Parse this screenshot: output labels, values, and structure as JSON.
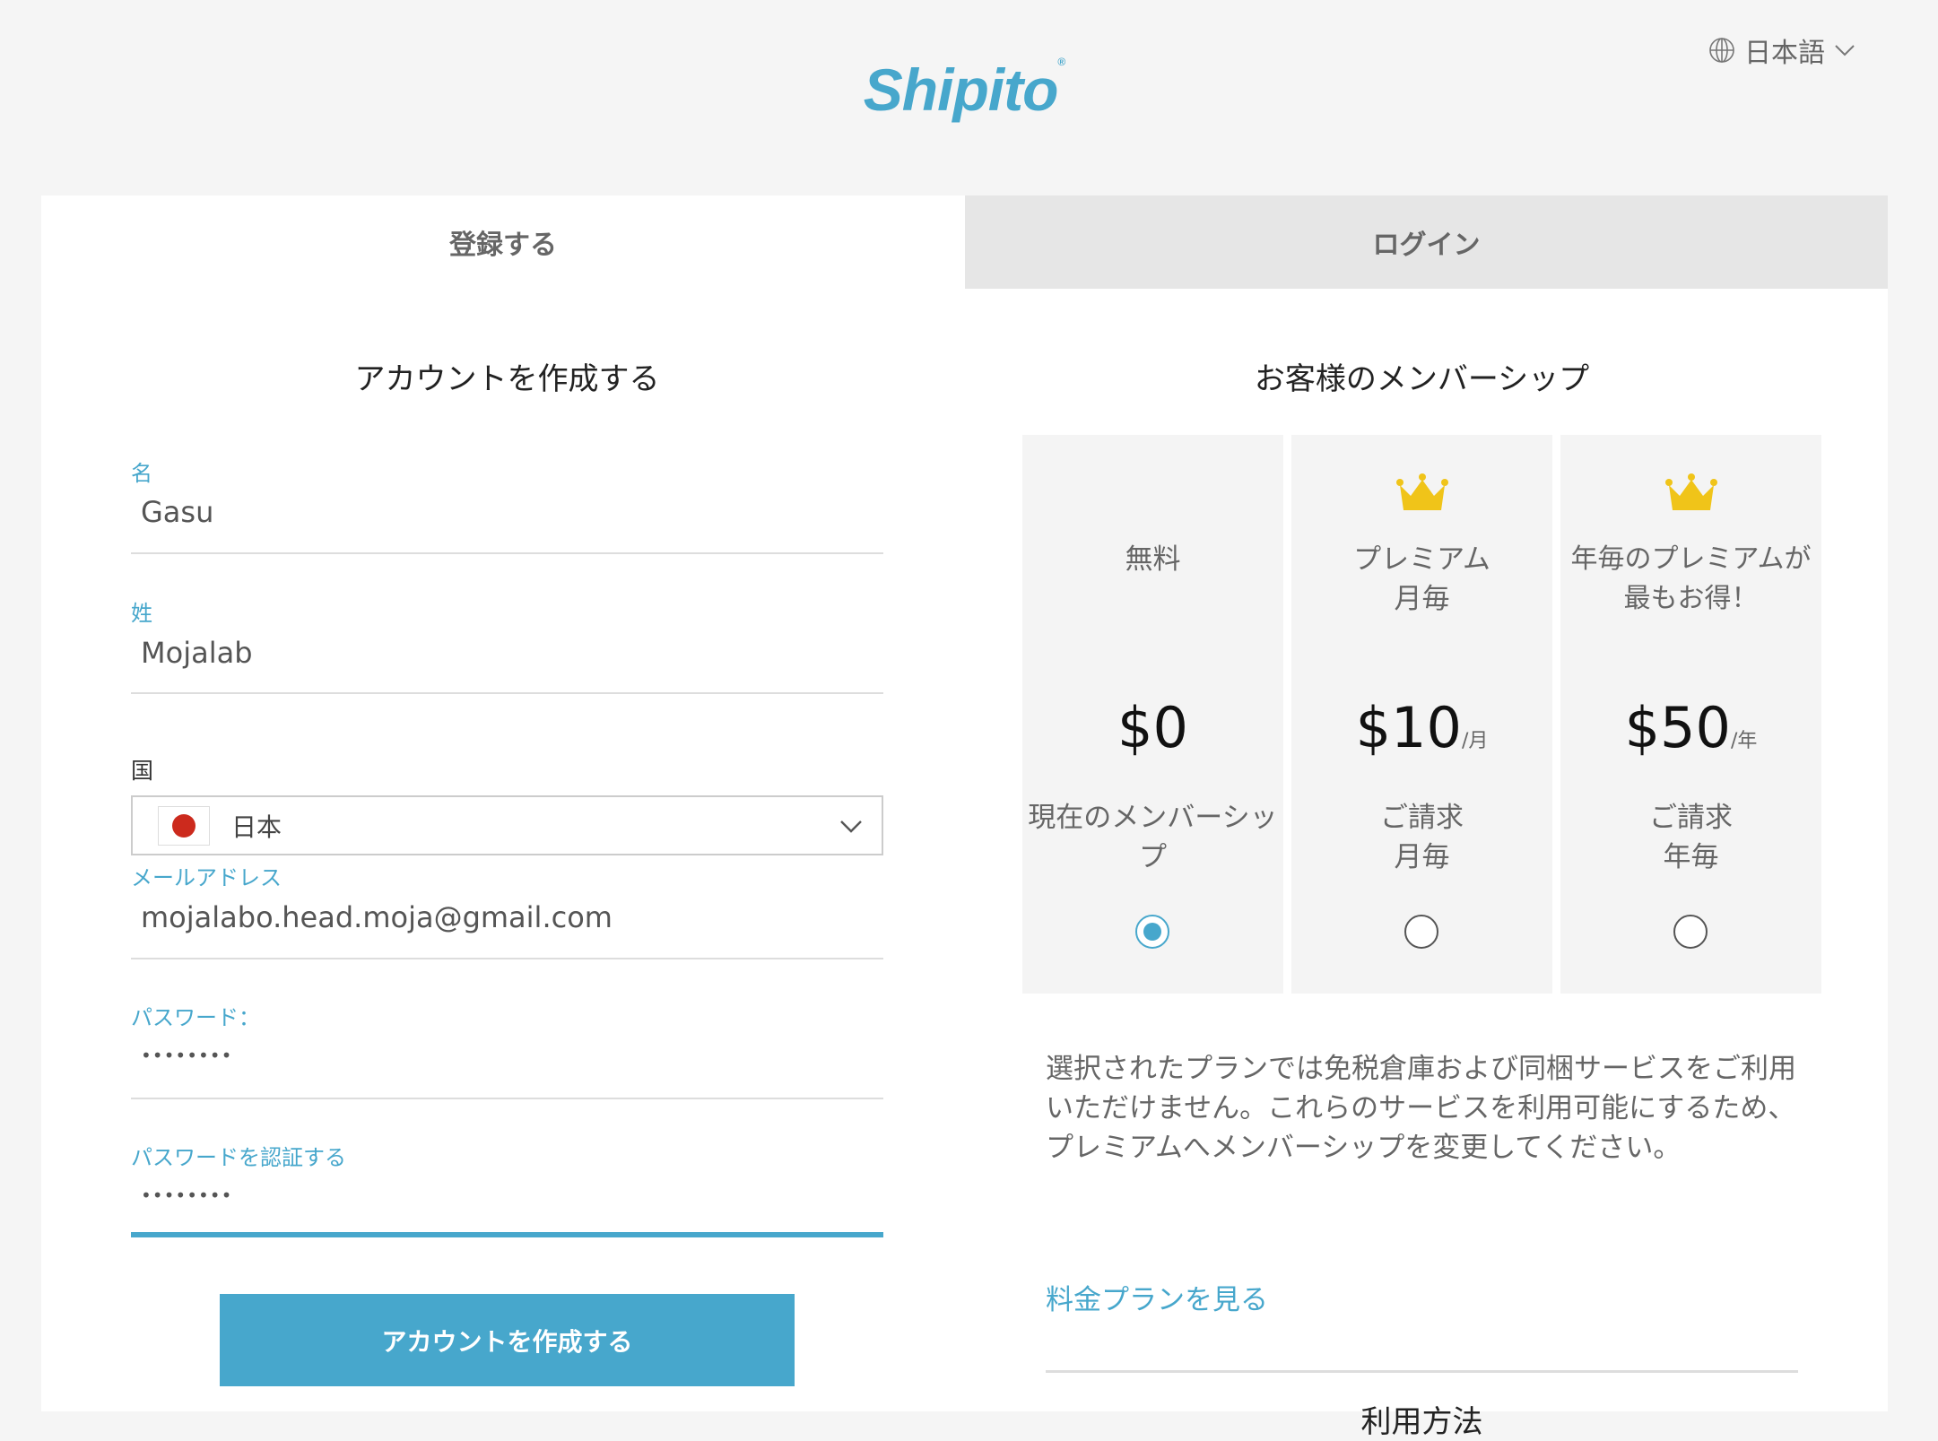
{
  "header": {
    "logo": "Shipito",
    "language": "日本語"
  },
  "tabs": {
    "register": "登録する",
    "login": "ログイン"
  },
  "form": {
    "title": "アカウントを作成する",
    "first_name": {
      "label": "名",
      "value": "Gasu"
    },
    "last_name": {
      "label": "姓",
      "value": "Mojalab"
    },
    "country": {
      "label": "国",
      "value": "日本"
    },
    "email": {
      "label": "メールアドレス",
      "value": "mojalabo.head.moja@gmail.com"
    },
    "password": {
      "label": "パスワード：",
      "value": "••••••••"
    },
    "confirm_password": {
      "label": "パスワードを認証する",
      "value": "••••••••"
    },
    "submit": "アカウントを作成する"
  },
  "membership": {
    "title": "お客様のメンバーシップ",
    "plans": [
      {
        "name": "無料",
        "price": "$0",
        "unit": "",
        "billing": "現在のメンバーシップ",
        "selected": true
      },
      {
        "name": "プレミアム\n月毎",
        "price": "$10",
        "unit": "/月",
        "billing": "ご請求\n月毎",
        "selected": false
      },
      {
        "name": "年毎のプレミアムが\n最もお得！",
        "price": "$50",
        "unit": "/年",
        "billing": "ご請求\n年毎",
        "selected": false
      }
    ],
    "description": "選択されたプランでは免税倉庫および同梱サービスをご利用いただけません。これらのサービスを利用可能にするため、プレミアムへメンバーシップを変更してください。",
    "pricing_link": "料金プランを見る",
    "next_heading": "利用方法"
  },
  "colors": {
    "accent": "#47a7cc",
    "crown": "#f0c419"
  }
}
